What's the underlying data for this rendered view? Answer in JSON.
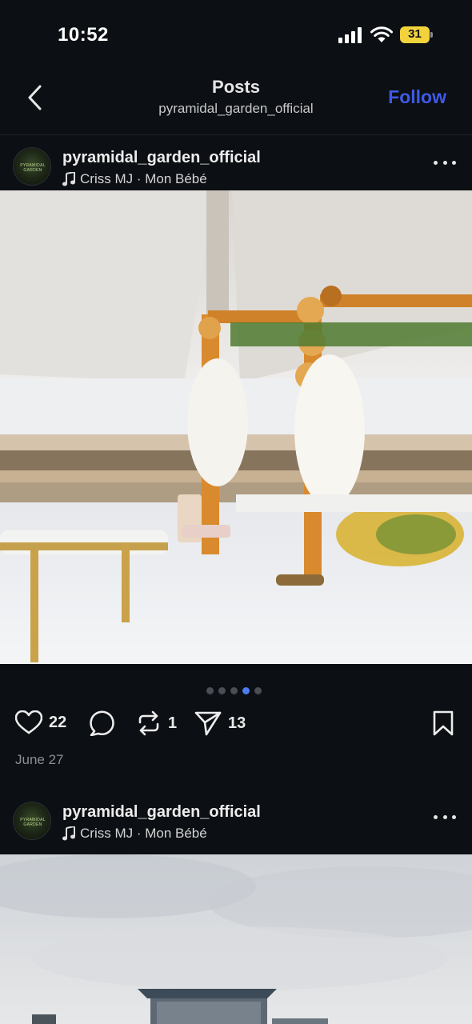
{
  "status_bar": {
    "time": "10:52",
    "battery": "31"
  },
  "nav": {
    "title": "Posts",
    "subtitle": "pyramidal_garden_official",
    "follow_label": "Follow"
  },
  "posts": [
    {
      "username": "pyramidal_garden_official",
      "music": "Criss MJ · Mon Bébé",
      "likes": "22",
      "reposts": "1",
      "shares": "13",
      "date": "June 27",
      "carousel": {
        "count": 5,
        "active": 3
      }
    },
    {
      "username": "pyramidal_garden_official",
      "music": "Criss MJ · Mon Bébé"
    }
  ],
  "colors": {
    "accent": "#3e5ae8",
    "battery": "#f3d33c",
    "carousel_active": "#4b7cf0"
  },
  "icons": [
    "back-chevron-icon",
    "signal-icon",
    "wifi-icon",
    "music-note-icon",
    "more-icon",
    "heart-icon",
    "comment-icon",
    "repost-icon",
    "share-icon",
    "bookmark-icon"
  ]
}
